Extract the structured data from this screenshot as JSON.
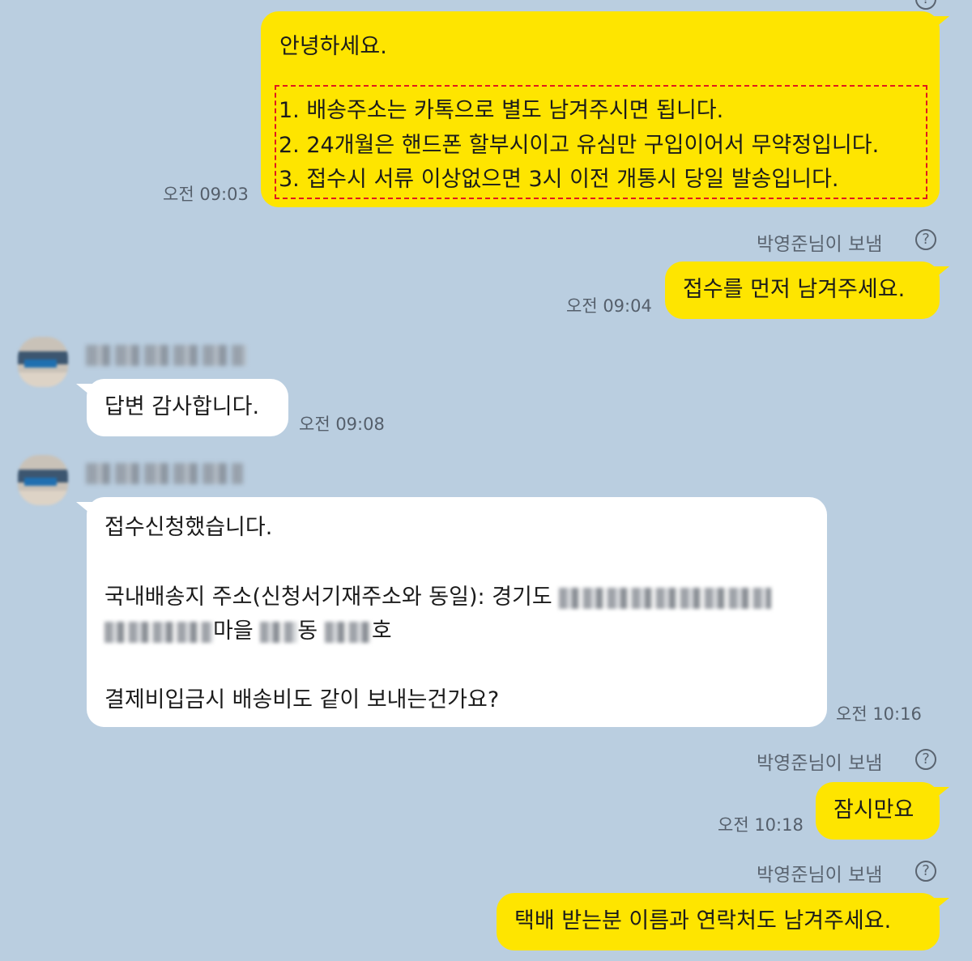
{
  "messages": {
    "m1": {
      "greeting": "안녕하세요.",
      "items": [
        "1. 배송주소는 카톡으로 별도 남겨주시면 됩니다.",
        "2. 24개월은 핸드폰 할부시이고 유심만 구입이어서 무약정입니다.",
        "3. 접수시 서류 이상없으면 3시 이전 개통시 당일 발송입니다."
      ],
      "time": "오전 09:03"
    },
    "sent_note_1": "박영준님이 보냄",
    "m2": {
      "text": "접수를 먼저 남겨주세요.",
      "time": "오전 09:04"
    },
    "m3": {
      "text": "답변 감사합니다.",
      "time": "오전 09:08"
    },
    "m4": {
      "line1": "접수신청했습니다.",
      "line2_prefix": "국내배송지 주소(신청서기재주소와 동일): 경기도",
      "line3_mid1": "마을",
      "line3_mid2": "동",
      "line3_suffix": "호",
      "line4": "결제비입금시 배송비도 같이 보내는건가요?",
      "time": "오전 10:16"
    },
    "sent_note_2": "박영준님이 보냄",
    "m5": {
      "text": "잠시만요",
      "time": "오전 10:18"
    },
    "sent_note_3": "박영준님이 보냄",
    "m6": {
      "text": "택배 받는분 이름과 연락처도 남겨주세요."
    }
  },
  "icons": {
    "help": "question-circle-icon",
    "avatar": "profile-avatar"
  },
  "colors": {
    "background": "#bacee0",
    "my_bubble": "#fee500",
    "their_bubble": "#ffffff",
    "highlight_border": "#e0191e"
  }
}
